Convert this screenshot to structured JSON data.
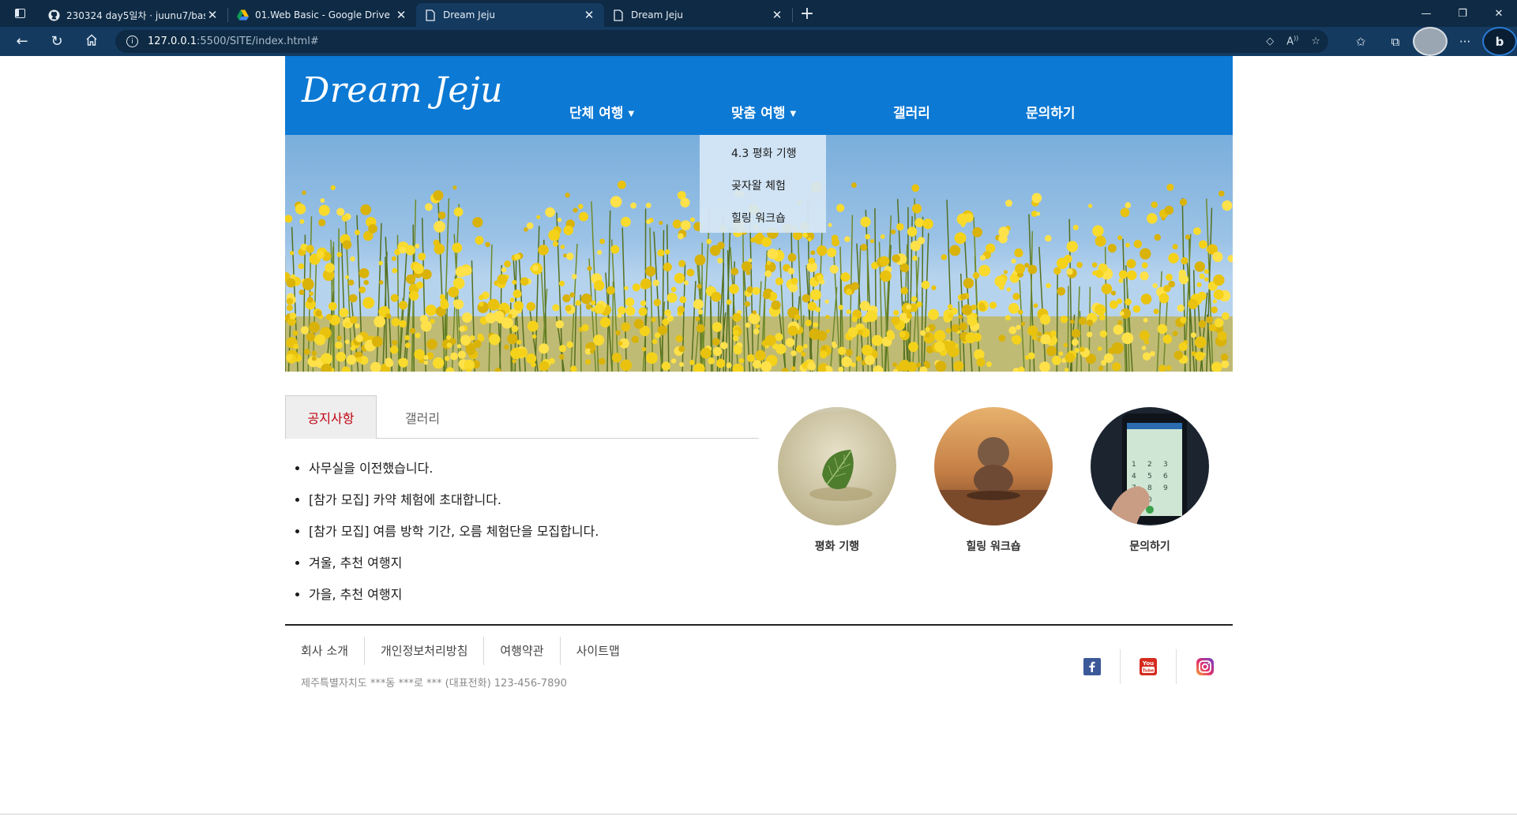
{
  "browser": {
    "tabs": [
      {
        "title": "230324 day5일차 · juunu7/basic",
        "icon": "github-icon"
      },
      {
        "title": "01.Web Basic - Google Drive",
        "icon": "google-drive-icon"
      },
      {
        "title": "Dream Jeju",
        "icon": "page-icon"
      },
      {
        "title": "Dream Jeju",
        "icon": "page-icon"
      }
    ],
    "url_host": "127.0.0.1",
    "url_path": ":5500/SITE/index.html#"
  },
  "site": {
    "logo": "Dream Jeju",
    "menu": [
      "단체 여행",
      "맞춤 여행",
      "갤러리",
      "문의하기"
    ],
    "submenu": [
      "4.3 평화 기행",
      "곶자왈 체험",
      "힐링 워크숍"
    ],
    "tabs": [
      "공지사항",
      "갤러리"
    ],
    "notices": [
      "사무실을 이전했습니다.",
      "[참가 모집] 카약 체험에 초대합니다.",
      "[참가 모집] 여름 방학 기간, 오름 체험단을 모집합니다.",
      "겨울, 추천 여행지",
      "가을, 추천 여행지"
    ],
    "circles": [
      "평화 기행",
      "힐링 워크숍",
      "문의하기"
    ],
    "footer": {
      "links": [
        "회사 소개",
        "개인정보처리방침",
        "여행약관",
        "사이트맵"
      ],
      "address": "제주특별자치도 ***동 ***로 *** (대표전화) 123-456-7890"
    },
    "colors": {
      "header": "#0c79d4",
      "active_tab": "#c0000f"
    }
  }
}
